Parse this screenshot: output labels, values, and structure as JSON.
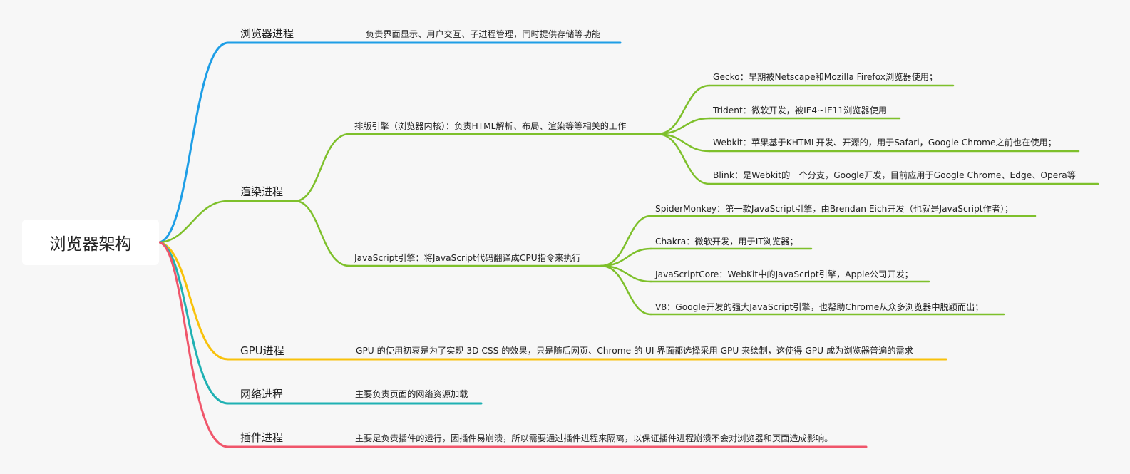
{
  "root": {
    "label": "浏览器架构"
  },
  "colors": {
    "browser": "#1e9ee6",
    "render": "#7ec02b",
    "gpu": "#f8c20c",
    "network": "#1fb1b3",
    "plugin": "#f0566b",
    "background": "#f7f7f7"
  },
  "branches": {
    "browser": {
      "label": "浏览器进程",
      "desc": "负责界面显示、用户交互、子进程管理，同时提供存储等功能"
    },
    "render": {
      "label": "渲染进程",
      "layout": {
        "label": "排版引擎（浏览器内核）：负责HTML解析、布局、渲染等等相关的工作",
        "items": [
          "Gecko：早期被Netscape和Mozilla Firefox浏览器使用；",
          "Trident：微软开发，被IE4~IE11浏览器使用",
          "Webkit：苹果基于KHTML开发、开源的，用于Safari，Google Chrome之前也在使用；",
          "Blink：是Webkit的一个分支，Google开发，目前应用于Google Chrome、Edge、Opera等"
        ]
      },
      "js": {
        "label": "JavaScript引擎：将JavaScript代码翻译成CPU指令来执行",
        "items": [
          "SpiderMonkey：第一款JavaScript引擎，由Brendan Eich开发（也就是JavaScript作者）；",
          "Chakra：微软开发，用于IT浏览器；",
          "JavaScriptCore：WebKit中的JavaScript引擎，Apple公司开发；",
          "V8：Google开发的强大JavaScript引擎，也帮助Chrome从众多浏览器中脱颖而出；"
        ]
      }
    },
    "gpu": {
      "label": "GPU进程",
      "desc": "GPU 的使用初衷是为了实现 3D CSS 的效果，只是随后网页、Chrome 的 UI 界面都选择采用 GPU 来绘制，这使得 GPU 成为浏览器普遍的需求"
    },
    "network": {
      "label": "网络进程",
      "desc": "主要负责页面的网络资源加载"
    },
    "plugin": {
      "label": "插件进程",
      "desc": "主要是负责插件的运行，因插件易崩溃，所以需要通过插件进程来隔离，以保证插件进程崩溃不会对浏览器和页面造成影响。"
    }
  }
}
